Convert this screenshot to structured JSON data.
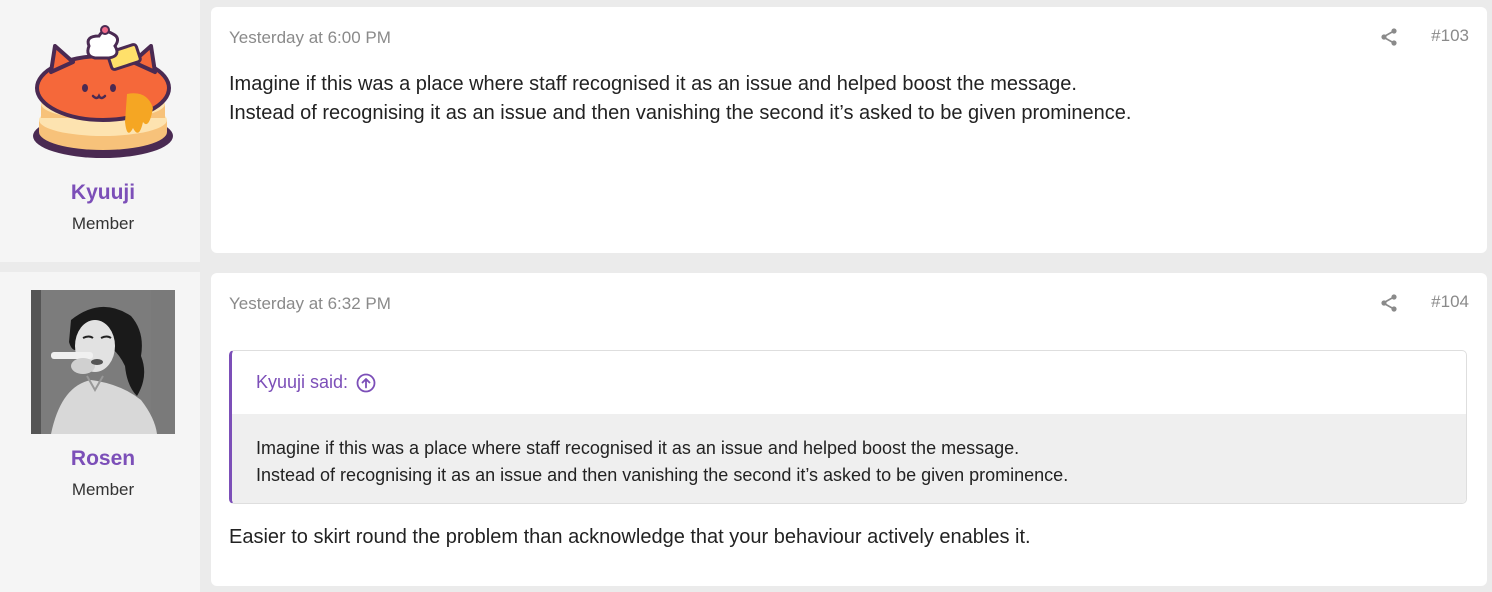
{
  "posts": [
    {
      "author": {
        "name": "Kyuuji",
        "title": "Member",
        "avatar": "pancake-cat-avatar"
      },
      "date": "Yesterday at 6:00 PM",
      "number": "#103",
      "body": [
        "Imagine if this was a place where staff recognised it as an issue and helped boost the message.",
        "Instead of recognising it as an issue and then vanishing the second it’s asked to be given prominence."
      ]
    },
    {
      "author": {
        "name": "Rosen",
        "title": "Member",
        "avatar": "bw-photo-avatar"
      },
      "date": "Yesterday at 6:32 PM",
      "number": "#104",
      "quote": {
        "attribution": "Kyuuji said:",
        "lines": [
          "Imagine if this was a place where staff recognised it as an issue and helped boost the message.",
          "Instead of recognising it as an issue and then vanishing the second it’s asked to be given prominence."
        ]
      },
      "body": [
        "Easier to skirt round the problem than acknowledge that your behaviour actively enables it."
      ]
    }
  ],
  "colors": {
    "accent": "#7c4fb8",
    "muted": "#8a8a8a",
    "quote_bg": "#efefef"
  },
  "icons": {
    "share": "share-icon",
    "jump": "arrow-up-circle-icon"
  }
}
